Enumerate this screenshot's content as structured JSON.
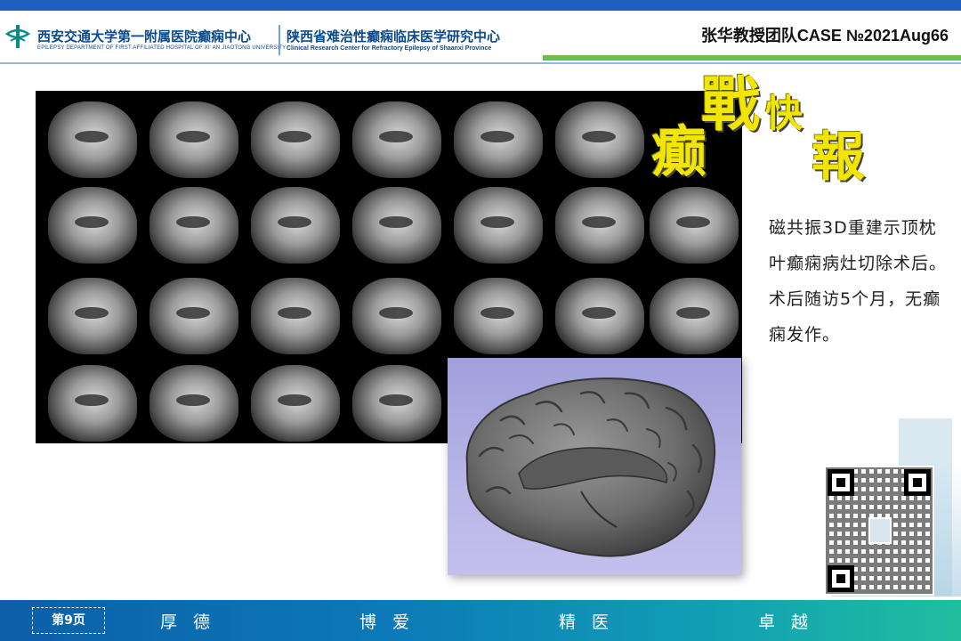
{
  "header": {
    "hospital_cn": "西安交通大学第一附属医院癫痫中心",
    "hospital_en": "EPILEPSY DEPARTMENT OF FIRST AFFILIATED HOSPITAL OF XI' AN JIAOTONG UNIVERSITY",
    "center_cn": "陕西省难治性癫痫临床医学研究中心",
    "center_en": "Clinical Research Center for Refractory Epilepsy of Shaanxi Province",
    "case_id": "张华教授团队CASE №2021Aug66"
  },
  "calligraphy": [
    "癫",
    "戰",
    "快",
    "報"
  ],
  "description": "磁共振3D重建示顶枕叶癫痫病灶切除术后。术后随访5个月，无癫痫发作。",
  "footer": {
    "page": "第9页",
    "mottos": [
      "厚 德",
      "博 爱",
      "精 医",
      "卓 越"
    ]
  },
  "colors": {
    "brand_blue": "#0b4a8b",
    "accent_green": "#6cc04a",
    "calligraphy_yellow": "#f2e600"
  }
}
